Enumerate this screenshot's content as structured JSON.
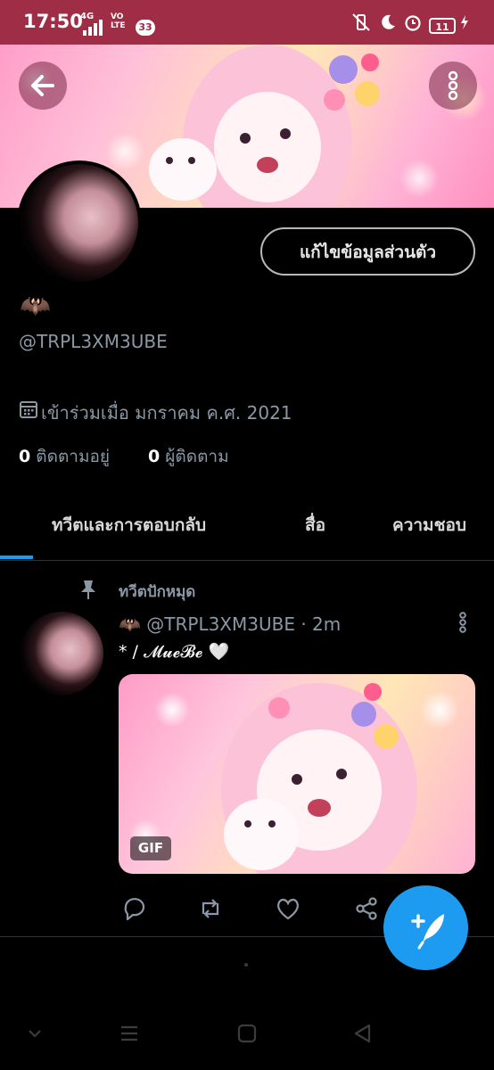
{
  "status_bar": {
    "time": "17:50",
    "network": "4G",
    "volte": "VO LTE",
    "notification_count": "33",
    "battery": "11"
  },
  "profile": {
    "display_name_emoji": "🦇",
    "handle": "@TRPL3XM3UBE",
    "edit_button_label": "แก้ไขข้อมูลส่วนตัว",
    "joined_text": "เข้าร่วมเมื่อ มกราคม ค.ศ. 2021",
    "following_count": "0",
    "following_label": "ติดตามอยู่",
    "followers_count": "0",
    "followers_label": "ผู้ติดตาม"
  },
  "tabs": [
    {
      "label": "ทวีตและการตอบกลับ",
      "active": true
    },
    {
      "label": "สื่อ",
      "active": false
    },
    {
      "label": "ความชอบ",
      "active": false
    }
  ],
  "tweet": {
    "pinned_label": "ทวีตปักหมุด",
    "author_emoji": "🦇",
    "header": "@TRPL3XM3UBE · 2m",
    "text": "* / 𝓜𝓾𝓮𝓑𝓮 🤍",
    "media_badge": "GIF"
  },
  "colors": {
    "status_bar": "#9e2d45",
    "accent": "#1d9bf0",
    "muted_text": "#8b98a5",
    "background": "#000000"
  }
}
